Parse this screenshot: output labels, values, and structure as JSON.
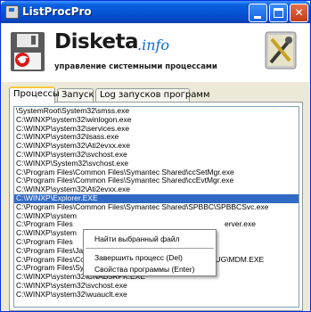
{
  "window": {
    "title": "ListProcPro"
  },
  "header": {
    "logo_main": "Disketa",
    "logo_suffix": ".info",
    "subtitle": "управление системными процессами"
  },
  "tabs": [
    {
      "label": "Процессы",
      "active": true
    },
    {
      "label": "Запуск",
      "active": false
    },
    {
      "label": "Log запусков программ",
      "active": false
    }
  ],
  "processes": [
    "\\SystemRoot\\System32\\smss.exe",
    "C:\\WINXP\\system32\\winlogon.exe",
    "C:\\WINXP\\system32\\services.exe",
    "C:\\WINXP\\system32\\lsass.exe",
    "C:\\WINXP\\system32\\Ati2evxx.exe",
    "C:\\WINXP\\system32\\svchost.exe",
    "C:\\WINXP\\System32\\svchost.exe",
    "C:\\Program Files\\Common Files\\Symantec Shared\\ccSetMgr.exe",
    "C:\\Program Files\\Common Files\\Symantec Shared\\ccEvtMgr.exe",
    "C:\\WINXP\\system32\\Ati2evxx.exe",
    "C:\\WINXP\\Explorer.EXE",
    "C:\\Program Files\\Common Files\\Symantec Shared\\SPBBC\\SPBBCSvc.exe",
    "C:\\WINXP\\system",
    "C:\\Program Files",
    "C:\\WINXP\\system",
    "C:\\Program Files",
    "C:\\Program Files\\Java\\jre6\\bin\\jqs.exe",
    "C:\\Program Files\\Common Files\\Microsoft Shared\\VS7DEBUG\\MDM.EXE",
    "C:\\Program Files\\Symantec AntiVirus\\Rtvscan.exe",
    "C:\\WINXP\\system32\\CNAB5RPK.EXE",
    "C:\\WINXP\\system32\\svchost.exe",
    "C:\\WINXP\\system32\\wuauclt.exe"
  ],
  "selected_index": 10,
  "context_menu": {
    "items": [
      "Найти выбранный файл",
      "Завершить процесс (Del)",
      "Свойства программы (Enter)"
    ],
    "obscured_fragment": "erver.exe"
  },
  "colors": {
    "selection": "#316ac5",
    "titlebar": "#0655d6",
    "logo_accent": "#0a6adf",
    "floppy_red": "#d81818"
  }
}
